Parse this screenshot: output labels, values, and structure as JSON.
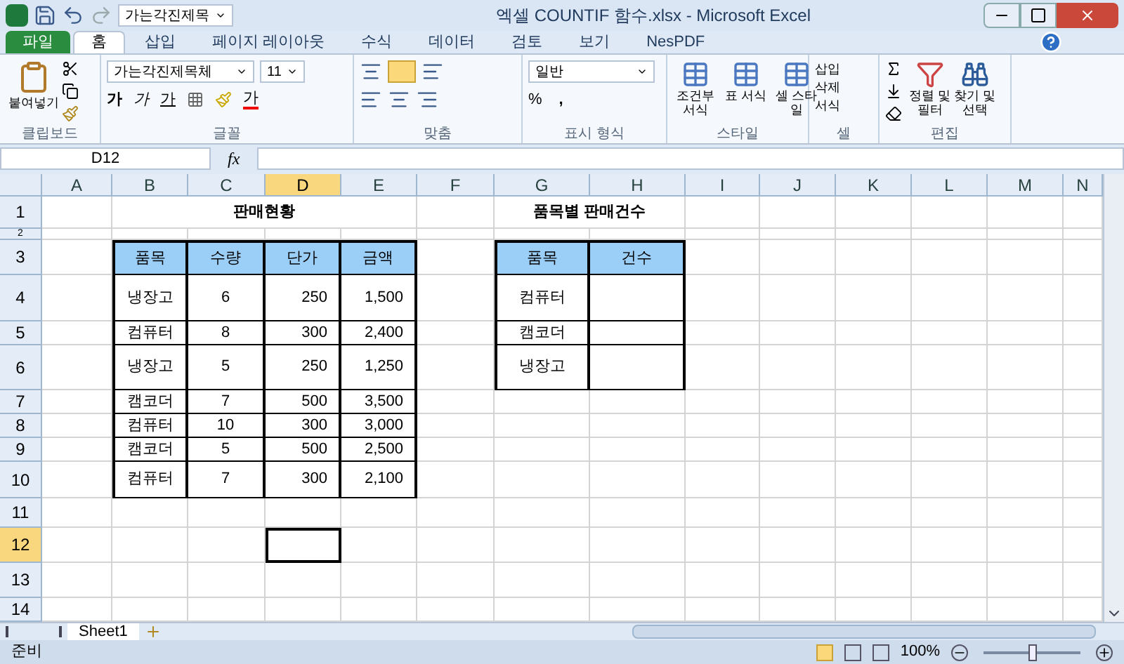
{
  "window": {
    "title": "엑셀 COUNTIF 함수.xlsx  -  Microsoft Excel",
    "quick_font": "가는각진제목"
  },
  "tabs": [
    {
      "label": "파일",
      "kind": "file",
      "selected": false
    },
    {
      "label": "홈",
      "kind": "tab",
      "selected": true
    },
    {
      "label": "삽입",
      "kind": "tab",
      "selected": false
    },
    {
      "label": "페이지 레이아웃",
      "kind": "tab",
      "selected": false
    },
    {
      "label": "수식",
      "kind": "tab",
      "selected": false
    },
    {
      "label": "데이터",
      "kind": "tab",
      "selected": false
    },
    {
      "label": "검토",
      "kind": "tab",
      "selected": false
    },
    {
      "label": "보기",
      "kind": "tab",
      "selected": false
    },
    {
      "label": "NesPDF",
      "kind": "tab",
      "selected": false
    }
  ],
  "ribbon": {
    "clipboard": {
      "paste": "붙여넣기",
      "group": "클립보드"
    },
    "font": {
      "name": "가는각진제목체",
      "size": "11",
      "bold": "가",
      "italic": "가",
      "underline": "가",
      "font_color": "가",
      "group": "글꼴"
    },
    "alignment": {
      "group": "맞춤"
    },
    "number": {
      "format": "일반",
      "percent": "%",
      "comma": ",",
      "group": "표시 형식"
    },
    "styles": {
      "items": [
        "조건부 서식",
        "표 서식",
        "셀 스타일"
      ],
      "group": "스타일"
    },
    "cells": {
      "items": [
        "삽입",
        "삭제",
        "서식"
      ],
      "group": "셀"
    },
    "editing": {
      "items": [
        "정렬 및 필터",
        "찾기 및 선택"
      ],
      "group": "편집"
    }
  },
  "formula_bar": {
    "name_box": "D12",
    "fx": "fx"
  },
  "sheet": {
    "columns": [
      {
        "label": "A",
        "selected": false
      },
      {
        "label": "B",
        "selected": false
      },
      {
        "label": "C",
        "selected": false
      },
      {
        "label": "D",
        "selected": true
      },
      {
        "label": "E",
        "selected": false
      },
      {
        "label": "F",
        "selected": false
      },
      {
        "label": "G",
        "selected": false
      },
      {
        "label": "H",
        "selected": false
      },
      {
        "label": "I",
        "selected": false
      },
      {
        "label": "J",
        "selected": false
      },
      {
        "label": "K",
        "selected": false
      },
      {
        "label": "L",
        "selected": false
      },
      {
        "label": "M",
        "selected": false
      },
      {
        "label": "N",
        "selected": false
      }
    ],
    "rows": [
      {
        "label": "1",
        "selected": false
      },
      {
        "label": "2",
        "selected": false
      },
      {
        "label": "3",
        "selected": false
      },
      {
        "label": "4",
        "selected": false
      },
      {
        "label": "5",
        "selected": false
      },
      {
        "label": "6",
        "selected": false
      },
      {
        "label": "7",
        "selected": false
      },
      {
        "label": "8",
        "selected": false
      },
      {
        "label": "9",
        "selected": false
      },
      {
        "label": "10",
        "selected": false
      },
      {
        "label": "11",
        "selected": false
      },
      {
        "label": "12",
        "selected": true
      },
      {
        "label": "13",
        "selected": false
      },
      {
        "label": "14",
        "selected": false
      }
    ],
    "titles": [
      "판매현황",
      "품목별  판매건수"
    ],
    "tables": [
      {
        "header": [
          "품목",
          "수량",
          "단가",
          "금액"
        ],
        "rows": [
          [
            "냉장고",
            "6",
            "250",
            "1,500"
          ],
          [
            "컴퓨터",
            "8",
            "300",
            "2,400"
          ],
          [
            "냉장고",
            "5",
            "250",
            "1,250"
          ],
          [
            "캠코더",
            "7",
            "500",
            "3,500"
          ],
          [
            "컴퓨터",
            "10",
            "300",
            "3,000"
          ],
          [
            "캠코더",
            "5",
            "500",
            "2,500"
          ],
          [
            "컴퓨터",
            "7",
            "300",
            "2,100"
          ]
        ]
      },
      {
        "header": [
          "품목",
          "건수"
        ],
        "rows": [
          [
            "컴퓨터"
          ],
          [
            "캠코더"
          ],
          [
            "냉장고"
          ]
        ]
      }
    ]
  },
  "sheet_tabs": [
    {
      "label": "Sheet1",
      "selected": true
    }
  ],
  "status_bar": {
    "status": "준비",
    "zoom": "100%",
    "zoom_level": {
      "level": 0.5
    }
  }
}
